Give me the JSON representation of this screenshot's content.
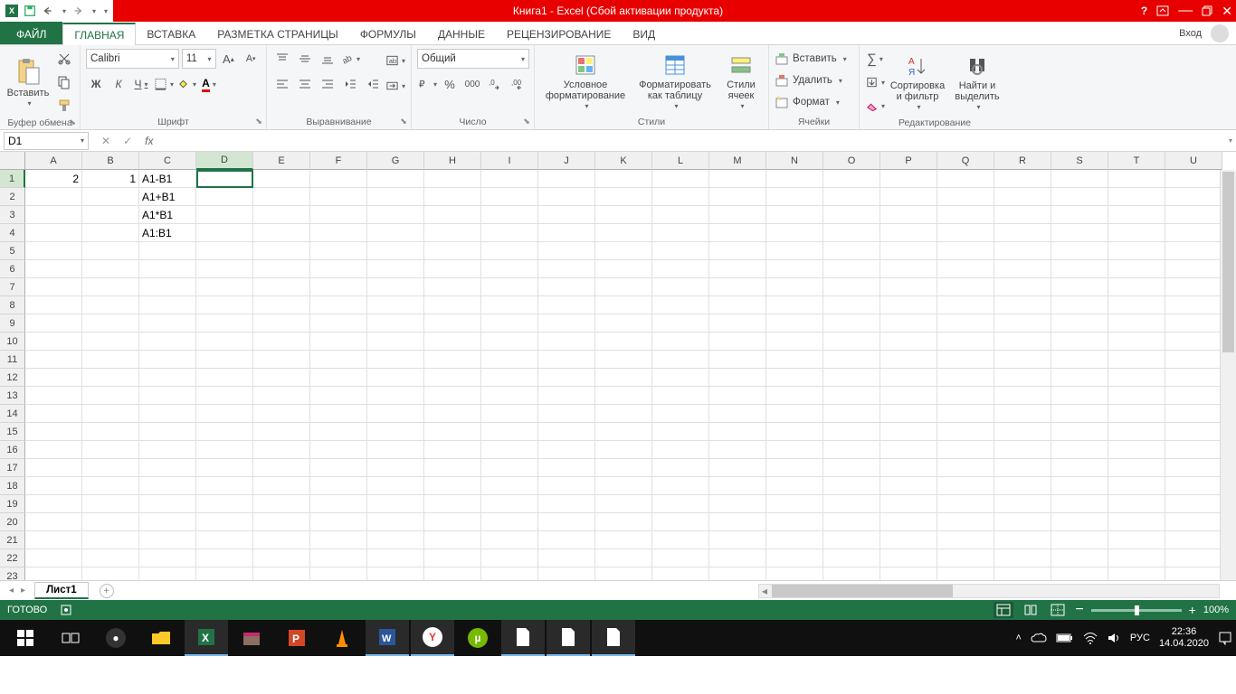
{
  "titlebar": {
    "title": "Книга1 -  Excel (Сбой активации продукта)"
  },
  "tabs": {
    "file": "ФАЙЛ",
    "home": "ГЛАВНАЯ",
    "insert": "ВСТАВКА",
    "layout": "РАЗМЕТКА СТРАНИЦЫ",
    "formulas": "ФОРМУЛЫ",
    "data": "ДАННЫЕ",
    "review": "РЕЦЕНЗИРОВАНИЕ",
    "view": "ВИД",
    "signin": "Вход"
  },
  "ribbon": {
    "clipboard": {
      "paste": "Вставить",
      "label": "Буфер обмена"
    },
    "font": {
      "name": "Calibri",
      "size": "11",
      "label": "Шрифт",
      "bold": "Ж",
      "italic": "К",
      "underline": "Ч"
    },
    "align": {
      "label": "Выравнивание"
    },
    "number": {
      "format": "Общий",
      "label": "Число"
    },
    "styles": {
      "cond": "Условное форматирование",
      "table": "Форматировать как таблицу",
      "cell": "Стили ячеек",
      "label": "Стили"
    },
    "cells": {
      "insert": "Вставить",
      "delete": "Удалить",
      "format": "Формат",
      "label": "Ячейки"
    },
    "editing": {
      "sort": "Сортировка и фильтр",
      "find": "Найти и выделить",
      "label": "Редактирование"
    }
  },
  "namebox": "D1",
  "columns": [
    "A",
    "B",
    "C",
    "D",
    "E",
    "F",
    "G",
    "H",
    "I",
    "J",
    "K",
    "L",
    "M",
    "N",
    "O",
    "P",
    "Q",
    "R",
    "S",
    "T",
    "U"
  ],
  "cells": {
    "A1": "2",
    "B1": "1",
    "C1": "A1-B1",
    "C2": "A1+B1",
    "C3": "A1*B1",
    "C4": "A1:B1"
  },
  "active_cell": "D1",
  "sheet": {
    "name": "Лист1"
  },
  "status": {
    "ready": "ГОТОВО",
    "zoom": "100%"
  },
  "systray": {
    "lang": "РУС",
    "time": "22:36",
    "date": "14.04.2020"
  }
}
